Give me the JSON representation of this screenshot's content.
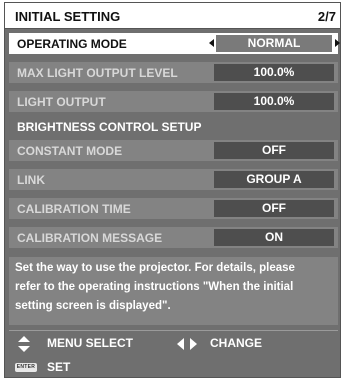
{
  "header": {
    "title": "INITIAL SETTING",
    "page": "2/7"
  },
  "rows": [
    {
      "label": "OPERATING MODE",
      "value": "NORMAL"
    },
    {
      "label": "MAX LIGHT OUTPUT LEVEL",
      "value": "100.0%"
    },
    {
      "label": "LIGHT OUTPUT",
      "value": "100.0%"
    },
    {
      "label": "BRIGHTNESS CONTROL SETUP"
    },
    {
      "label": "CONSTANT MODE",
      "value": "OFF"
    },
    {
      "label": "LINK",
      "value": "GROUP A"
    },
    {
      "label": "CALIBRATION TIME",
      "value": "OFF"
    },
    {
      "label": "CALIBRATION MESSAGE",
      "value": "ON"
    }
  ],
  "description": {
    "line1": "Set the way to use the projector. For details, please",
    "line2": "refer to the operating instructions \"When the initial",
    "line3": "setting screen is displayed\"."
  },
  "footer": {
    "menu_select": "MENU SELECT",
    "change": "CHANGE",
    "enter_key": "ENTER",
    "set": "SET"
  }
}
